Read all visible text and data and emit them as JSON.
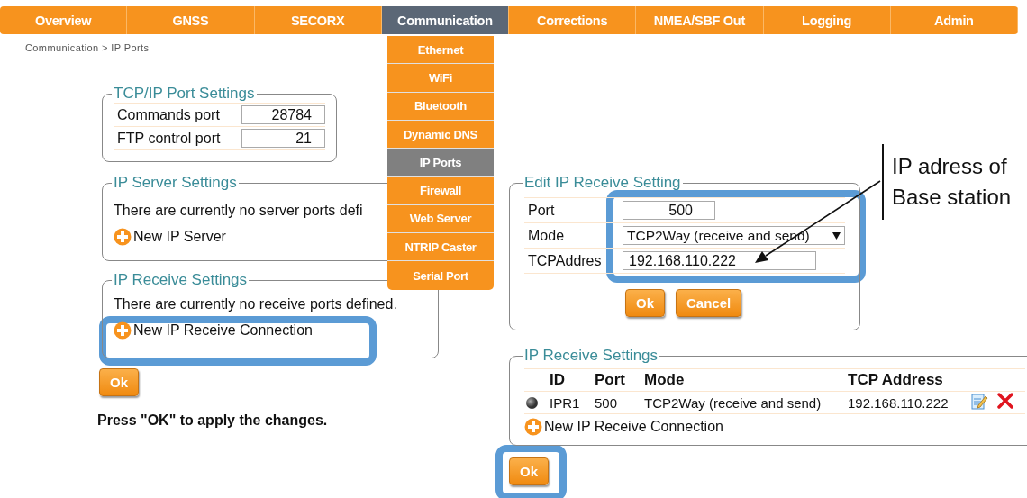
{
  "nav_tabs": [
    {
      "label": "Overview",
      "selected": false
    },
    {
      "label": "GNSS",
      "selected": false
    },
    {
      "label": "SECORX",
      "selected": false
    },
    {
      "label": "Communication",
      "selected": true
    },
    {
      "label": "Corrections",
      "selected": false
    },
    {
      "label": "NMEA/SBF Out",
      "selected": false
    },
    {
      "label": "Logging",
      "selected": false
    },
    {
      "label": "Admin",
      "selected": false
    }
  ],
  "breadcrumb": "Communication > IP Ports",
  "dropdown_menu": [
    {
      "label": "Ethernet",
      "selected": false
    },
    {
      "label": "WiFi",
      "selected": false
    },
    {
      "label": "Bluetooth",
      "selected": false
    },
    {
      "label": "Dynamic DNS",
      "selected": false
    },
    {
      "label": "IP Ports",
      "selected": true
    },
    {
      "label": "Firewall",
      "selected": false
    },
    {
      "label": "Web Server",
      "selected": false
    },
    {
      "label": "NTRIP Caster",
      "selected": false
    },
    {
      "label": "Serial Port",
      "selected": false
    }
  ],
  "tcp_ip_port_settings": {
    "title": "TCP/IP Port Settings",
    "fields": [
      {
        "label": "Commands port",
        "value": "28784"
      },
      {
        "label": "FTP control port",
        "value": "21"
      }
    ]
  },
  "ip_server_settings": {
    "title": "IP Server Settings",
    "message": "There are currently no server ports defi",
    "add_link": "New IP Server"
  },
  "ip_receive_settings": {
    "title": "IP Receive Settings",
    "message": "There are currently no receive ports defined.",
    "add_link": "New IP Receive Connection"
  },
  "ok_button": "Ok",
  "apply_note": "Press \"OK\" to apply the changes.",
  "edit_ip_receive_setting": {
    "title": "Edit IP Receive Setting",
    "fields": [
      {
        "kind": "text",
        "label": "Port",
        "value": "500"
      },
      {
        "kind": "select",
        "label": "Mode",
        "value": "TCP2Way (receive and send)"
      },
      {
        "kind": "address",
        "label": "TCPAddres",
        "value": "192.168.110.222"
      }
    ],
    "buttons": [
      "Ok",
      "Cancel"
    ]
  },
  "callout": {
    "lines": [
      "IP adress of",
      "Base station"
    ]
  },
  "ip_receive_list": {
    "title": "IP Receive Settings",
    "columns": [
      "ID",
      "Port",
      "Mode",
      "TCP Address"
    ],
    "rows": [
      {
        "id": "IPR1",
        "port": "500",
        "mode": "TCP2Way (receive and send)",
        "tcp_address": "192.168.110.222"
      }
    ],
    "add_link": "New IP Receive Connection",
    "ok_button": "Ok"
  }
}
